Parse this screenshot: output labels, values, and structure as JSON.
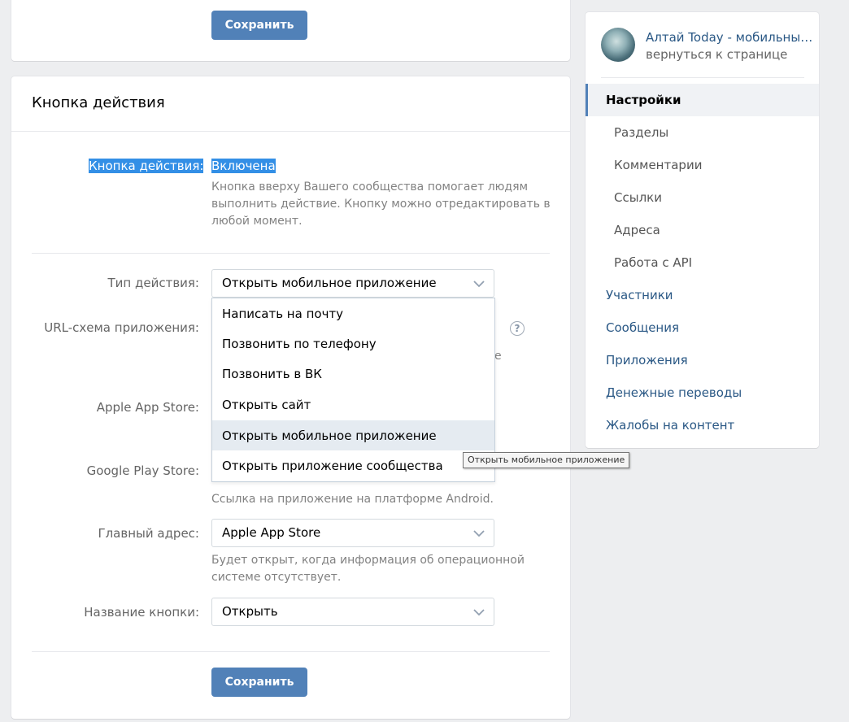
{
  "top_card": {
    "save_label": "Сохранить"
  },
  "action_card": {
    "title": "Кнопка действия",
    "status_label": "Кнопка действия:",
    "status_value": "Включена",
    "status_hint": [
      "Кнопка вверху Вашего сообщества помогает людям",
      "выполнить действие. Кнопку можно отредактировать в",
      "любой момент."
    ],
    "action_type_label": "Тип действия:",
    "action_type_value": "Открыть мобильное приложение",
    "url_scheme_label": "URL-схема приложения:",
    "help_glyph": "?",
    "url_hint_fragment": "е",
    "apple_label": "Apple App Store:",
    "google_label": "Google Play Store:",
    "google_hint": "Ссылка на приложение на платформе Android.",
    "main_address_label": "Главный адрес:",
    "main_address_value": "Apple App Store",
    "main_address_hint": [
      "Будет открыт, когда информация об операционной",
      "системе отсутствует."
    ],
    "button_name_label": "Название кнопки:",
    "button_name_value": "Открыть",
    "save_label": "Сохранить"
  },
  "dropdown": {
    "options": [
      "Написать на почту",
      "Позвонить по телефону",
      "Позвонить в ВК",
      "Открыть сайт",
      "Открыть мобильное приложение",
      "Открыть приложение сообщества"
    ],
    "hovered_index": 4,
    "tooltip": "Открыть мобильное приложение"
  },
  "sidebar": {
    "community_name": "Алтай Today - мобильны…",
    "back_link": "вернуться к странице",
    "items": [
      {
        "label": "Настройки",
        "active": true,
        "sub": false
      },
      {
        "label": "Разделы",
        "active": false,
        "sub": true
      },
      {
        "label": "Комментарии",
        "active": false,
        "sub": true
      },
      {
        "label": "Ссылки",
        "active": false,
        "sub": true
      },
      {
        "label": "Адреса",
        "active": false,
        "sub": true
      },
      {
        "label": "Работа с API",
        "active": false,
        "sub": true
      },
      {
        "label": "Участники",
        "active": false,
        "sub": false
      },
      {
        "label": "Сообщения",
        "active": false,
        "sub": false
      },
      {
        "label": "Приложения",
        "active": false,
        "sub": false
      },
      {
        "label": "Денежные переводы",
        "active": false,
        "sub": false
      },
      {
        "label": "Жалобы на контент",
        "active": false,
        "sub": false
      }
    ]
  },
  "colors": {
    "accent": "#5181b8",
    "link": "#2a5885",
    "selection": "#338fe6",
    "background": "#edeef0"
  }
}
